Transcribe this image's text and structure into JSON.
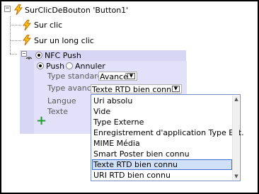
{
  "tree": {
    "root_label": "SurClicDeBouton 'Button1'",
    "root_expander": "−",
    "items": [
      {
        "label": "Sur clic"
      },
      {
        "label": "Sur un long clic"
      }
    ],
    "nfc": {
      "expander": "−",
      "label": "NFC Push",
      "push_label": "Push",
      "cancel_label": "Annuler",
      "fields": [
        {
          "label": "Type standard",
          "value": "Avancé"
        },
        {
          "label": "Type avancé",
          "value": "Texte RTD bien connu"
        },
        {
          "label": "Langue"
        },
        {
          "label": "Texte"
        }
      ],
      "add_symbol": "+"
    }
  },
  "dropdown": {
    "options": [
      "Uri absolu",
      "Vide",
      "Type Externe",
      "Enregistrement d'application Type Ext.",
      "MIME Média",
      "Smart Poster bien connu",
      "Texte RTD bien connu",
      "URI RTD bien connu"
    ],
    "selected": "Texte RTD bien connu",
    "arrow": "▼"
  },
  "colors": {
    "bolt_fill": "#f5c518",
    "bolt_stroke": "#c46a00",
    "nfc_panel": "#d8d6f5",
    "push_panel": "#e3e1fa",
    "selection": "#cfe0f7",
    "add_icon": "#1e9e2a"
  }
}
